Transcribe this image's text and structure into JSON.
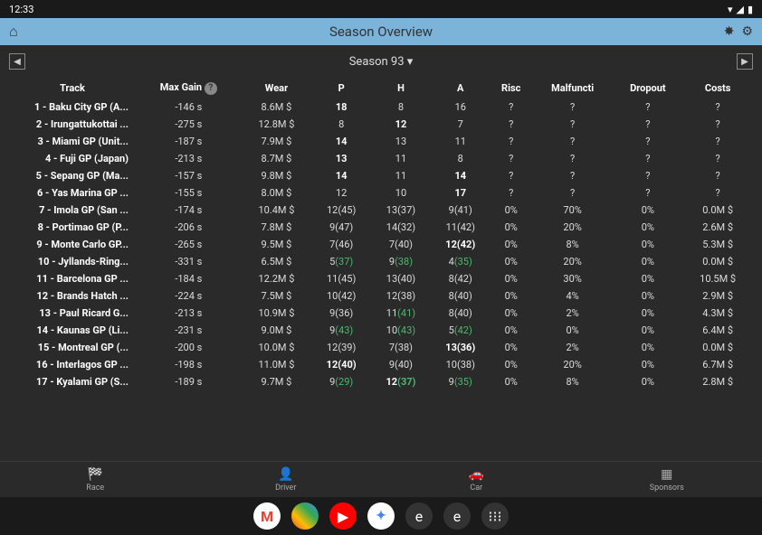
{
  "status": {
    "time": "12:33"
  },
  "header": {
    "title": "Season Overview"
  },
  "season": {
    "label": "Season 93"
  },
  "columns": [
    "Track",
    "Max Gain",
    "Wear",
    "P",
    "H",
    "A",
    "Risc",
    "Malfuncti",
    "Dropout",
    "Costs"
  ],
  "rows": [
    {
      "track": "1 - Baku City GP (A...",
      "maxgain": "-146 s",
      "wear": "8.6M $",
      "p": {
        "v": "18",
        "b": true
      },
      "h": {
        "v": "8"
      },
      "a": {
        "v": "16"
      },
      "risc": "?",
      "mal": "?",
      "drop": "?",
      "costs": "?"
    },
    {
      "track": "2 - Irungattukottai ...",
      "maxgain": "-275 s",
      "wear": "12.8M $",
      "p": {
        "v": "8"
      },
      "h": {
        "v": "12",
        "b": true
      },
      "a": {
        "v": "7"
      },
      "risc": "?",
      "mal": "?",
      "drop": "?",
      "costs": "?"
    },
    {
      "track": "3 - Miami GP (Unit...",
      "maxgain": "-187 s",
      "wear": "7.9M $",
      "p": {
        "v": "14",
        "b": true
      },
      "h": {
        "v": "13"
      },
      "a": {
        "v": "11"
      },
      "risc": "?",
      "mal": "?",
      "drop": "?",
      "costs": "?"
    },
    {
      "track": "4 - Fuji GP (Japan)",
      "maxgain": "-213 s",
      "wear": "8.7M $",
      "p": {
        "v": "13",
        "b": true
      },
      "h": {
        "v": "11"
      },
      "a": {
        "v": "8"
      },
      "risc": "?",
      "mal": "?",
      "drop": "?",
      "costs": "?"
    },
    {
      "track": "5 - Sepang GP (Ma...",
      "maxgain": "-157 s",
      "wear": "9.8M $",
      "p": {
        "v": "14",
        "b": true
      },
      "h": {
        "v": "11"
      },
      "a": {
        "v": "14",
        "b": true
      },
      "risc": "?",
      "mal": "?",
      "drop": "?",
      "costs": "?"
    },
    {
      "track": "6 - Yas Marina GP ...",
      "maxgain": "-155 s",
      "wear": "8.0M $",
      "p": {
        "v": "12"
      },
      "h": {
        "v": "10"
      },
      "a": {
        "v": "17",
        "b": true
      },
      "risc": "?",
      "mal": "?",
      "drop": "?",
      "costs": "?"
    },
    {
      "track": "7 - Imola GP (San ...",
      "maxgain": "-174 s",
      "wear": "10.4M $",
      "p": {
        "v": "12(45)"
      },
      "h": {
        "v": "13(37)"
      },
      "a": {
        "v": "9(41)"
      },
      "risc": "0%",
      "mal": "70%",
      "drop": "0%",
      "costs": "0.0M $"
    },
    {
      "track": "8 - Portimao GP (P...",
      "maxgain": "-206 s",
      "wear": "7.8M $",
      "p": {
        "v": "9(47)"
      },
      "h": {
        "v": "14(32)"
      },
      "a": {
        "v": "11(42)"
      },
      "risc": "0%",
      "mal": "20%",
      "drop": "0%",
      "costs": "2.6M $"
    },
    {
      "track": "9 - Monte Carlo GP...",
      "maxgain": "-265 s",
      "wear": "9.5M $",
      "p": {
        "v": "7(46)"
      },
      "h": {
        "v": "7(40)"
      },
      "a": {
        "v": "12(42)",
        "b": true
      },
      "risc": "0%",
      "mal": "8%",
      "drop": "0%",
      "costs": "5.3M $"
    },
    {
      "track": "10 - Jyllands-Ring...",
      "maxgain": "-331 s",
      "wear": "6.5M $",
      "p": {
        "v": "5",
        "p": "(37)",
        "g": true
      },
      "h": {
        "v": "9",
        "p": "(38)",
        "g": true
      },
      "a": {
        "v": "4",
        "p": "(35)",
        "g": true
      },
      "risc": "0%",
      "mal": "20%",
      "drop": "0%",
      "costs": "0.0M $"
    },
    {
      "track": "11 - Barcelona GP ...",
      "maxgain": "-184 s",
      "wear": "12.2M $",
      "p": {
        "v": "11(45)"
      },
      "h": {
        "v": "13(40)"
      },
      "a": {
        "v": "8(42)"
      },
      "risc": "0%",
      "mal": "30%",
      "drop": "0%",
      "costs": "10.5M $"
    },
    {
      "track": "12 - Brands Hatch ...",
      "maxgain": "-224 s",
      "wear": "7.5M $",
      "p": {
        "v": "10(42)"
      },
      "h": {
        "v": "12(38)"
      },
      "a": {
        "v": "8(40)"
      },
      "risc": "0%",
      "mal": "4%",
      "drop": "0%",
      "costs": "2.9M $"
    },
    {
      "track": "13 - Paul Ricard G...",
      "maxgain": "-213 s",
      "wear": "10.9M $",
      "p": {
        "v": "9(36)"
      },
      "h": {
        "v": "11",
        "p": "(41)",
        "g": true
      },
      "a": {
        "v": "8(40)"
      },
      "risc": "0%",
      "mal": "2%",
      "drop": "0%",
      "costs": "4.3M $"
    },
    {
      "track": "14 - Kaunas GP (Li...",
      "maxgain": "-231 s",
      "wear": "9.0M $",
      "p": {
        "v": "9",
        "p": "(43)",
        "g": true
      },
      "h": {
        "v": "10",
        "p": "(43)",
        "g": true
      },
      "a": {
        "v": "5",
        "p": "(42)",
        "g": true
      },
      "risc": "0%",
      "mal": "0%",
      "drop": "0%",
      "costs": "6.4M $"
    },
    {
      "track": "15 - Montreal GP (...",
      "maxgain": "-200 s",
      "wear": "10.0M $",
      "p": {
        "v": "12(39)"
      },
      "h": {
        "v": "7(38)"
      },
      "a": {
        "v": "13(36)",
        "b": true
      },
      "risc": "0%",
      "mal": "2%",
      "drop": "0%",
      "costs": "0.0M $"
    },
    {
      "track": "16 - Interlagos GP ...",
      "maxgain": "-198 s",
      "wear": "11.0M $",
      "p": {
        "v": "12(40)",
        "b": true
      },
      "h": {
        "v": "9(40)"
      },
      "a": {
        "v": "10(38)"
      },
      "risc": "0%",
      "mal": "20%",
      "drop": "0%",
      "costs": "6.7M $"
    },
    {
      "track": "17 - Kyalami GP (S...",
      "maxgain": "-189 s",
      "wear": "9.7M $",
      "p": {
        "v": "9",
        "p": "(29)",
        "g": true
      },
      "h": {
        "v": "12",
        "p": "(37)",
        "g": true,
        "b": true
      },
      "a": {
        "v": "9",
        "p": "(35)",
        "g": true
      },
      "risc": "0%",
      "mal": "8%",
      "drop": "0%",
      "costs": "2.8M $"
    }
  ],
  "bottom_nav": [
    {
      "label": "Race",
      "icon": "🏁"
    },
    {
      "label": "Driver",
      "icon": "👤"
    },
    {
      "label": "Car",
      "icon": "🚗"
    },
    {
      "label": "Sponsors",
      "icon": "▦"
    }
  ]
}
